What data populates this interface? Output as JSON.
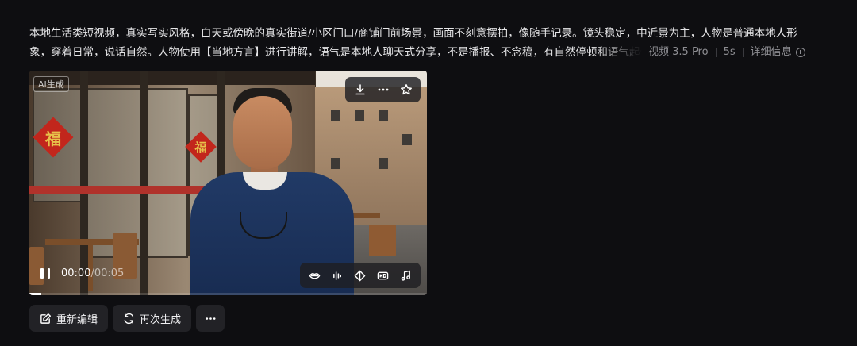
{
  "prompt": {
    "line1": "本地生活类短视频，真实写实风格，白天或傍晚的真实街道/小区门口/商铺门前场景，画面不刻意摆拍，像随手记录。镜头稳定，中近景为主，人物是普通本地人形",
    "line2": "象，穿着日常，说话自然。人物使用【当地方言】进行讲解，语气是本地人聊天式分享，不是播报、不念稿，有自然停顿和语气起伏"
  },
  "meta": {
    "model": "视频 3.5 Pro",
    "duration": "5s",
    "details_label": "详细信息"
  },
  "video": {
    "ai_tag": "AI生成",
    "sign_char": "福",
    "time_current": "00:00",
    "time_separator": "/",
    "time_total": "00:05",
    "progress_fraction": 0.03
  },
  "icons": {
    "download": "download-icon",
    "more": "more-icon",
    "favorite": "star-icon",
    "lipsync": "lip-icon",
    "voice": "waveform-icon",
    "frames": "diamond-icon",
    "hd": "hd-icon",
    "music": "music-note-icon"
  },
  "actions": {
    "reedit_label": "重新编辑",
    "regenerate_label": "再次生成"
  }
}
